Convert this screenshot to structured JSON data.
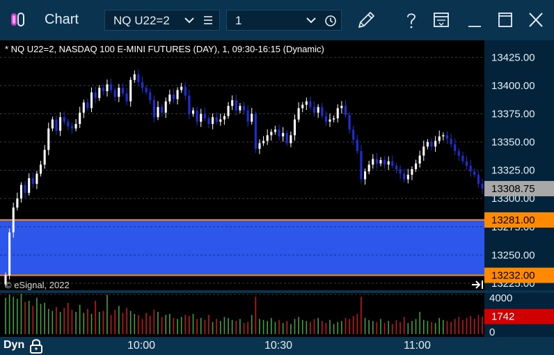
{
  "window": {
    "title": "Chart",
    "symbol": "NQ U22=2",
    "interval": "1",
    "icons": [
      "pencil-icon",
      "help-icon",
      "layout-icon",
      "minimize-icon",
      "maximize-icon",
      "close-icon"
    ]
  },
  "header": {
    "description": "* NQ U22=2, NASDAQ 100 E-MINI FUTURES (DAY), 1, 09:30-16:15 (Dynamic)"
  },
  "footer": {
    "copyright": "© eSignal, 2022",
    "mode": "Dyn"
  },
  "colors": {
    "title_bar": "#0a3350",
    "up_candle": "#ffffff",
    "down_candle": "#1e2ed8",
    "zone_fill": "#2f59f5",
    "zone_border": "#ff8a00",
    "last_price_tag": "#a8a8a8",
    "volume_tag": "#d00000",
    "volume_up": "#3ea23e",
    "volume_down": "#c41818"
  },
  "chart_data": {
    "type": "candlestick",
    "symbol": "NQ U22=2",
    "x_ticks": [
      "10:00",
      "10:30",
      "11:00"
    ],
    "price_ticks": [
      13425,
      13400,
      13375,
      13350,
      13325,
      13300,
      13275,
      13250,
      13225
    ],
    "price_tick_labels": [
      "13425.00",
      "13400.00",
      "13375.00",
      "13350.00",
      "13325.00",
      "13300.00",
      "13275.00",
      "13250.00",
      "13225.00"
    ],
    "ylim": [
      13220,
      13440
    ],
    "grid": true,
    "last_price": "13308.75",
    "last_price_value": 13308.75,
    "zone": {
      "upper": 13281,
      "lower": 13232,
      "upper_label": "13281.00",
      "lower_label": "13232.00"
    },
    "volume": {
      "axis_max_label": "4000",
      "axis_min_label": "0",
      "axis_max": 4000,
      "last_label": "1742",
      "last": 1742
    },
    "close_series": [
      13232,
      13270,
      13292,
      13300,
      13312,
      13305,
      13318,
      13313,
      13322,
      13330,
      13343,
      13362,
      13370,
      13360,
      13372,
      13368,
      13364,
      13362,
      13366,
      13376,
      13385,
      13380,
      13394,
      13389,
      13398,
      13395,
      13401,
      13396,
      13390,
      13398,
      13393,
      13386,
      13405,
      13410,
      13403,
      13398,
      13394,
      13387,
      13372,
      13381,
      13376,
      13386,
      13392,
      13388,
      13396,
      13399,
      13391,
      13375,
      13378,
      13368,
      13375,
      13371,
      13366,
      13372,
      13368,
      13370,
      13373,
      13382,
      13387,
      13378,
      13382,
      13378,
      13368,
      13375,
      13344,
      13349,
      13351,
      13356,
      13359,
      13361,
      13355,
      13358,
      13349,
      13356,
      13370,
      13380,
      13383,
      13386,
      13381,
      13376,
      13381,
      13373,
      13368,
      13370,
      13371,
      13380,
      13382,
      13374,
      13361,
      13352,
      13342,
      13317,
      13324,
      13330,
      13335,
      13331,
      13334,
      13330,
      13333,
      13329,
      13326,
      13322,
      13317,
      13321,
      13326,
      13331,
      13338,
      13346,
      13350,
      13346,
      13351,
      13355,
      13356,
      13353,
      13348,
      13342,
      13338,
      13333,
      13329,
      13324,
      13321,
      13313,
      13308.75
    ],
    "volume_series": [
      3600,
      3900,
      3700,
      3500,
      4000,
      3200,
      3300,
      2800,
      3600,
      3000,
      3100,
      2500,
      2300,
      2700,
      2200,
      2600,
      3100,
      2400,
      2200,
      2900,
      2100,
      2500,
      2000,
      3300,
      2200,
      2300,
      3900,
      1900,
      2400,
      2800,
      2100,
      2600,
      2300,
      2000,
      1900,
      1500,
      2100,
      1800,
      2400,
      2200,
      1700,
      1900,
      2000,
      1600,
      1500,
      1700,
      1900,
      1800,
      2000,
      1500,
      1600,
      1400,
      1900,
      1200,
      1500,
      1300,
      1700,
      1600,
      1400,
      1300,
      1500,
      1100,
      1200,
      1900,
      3700,
      1500,
      1400,
      1300,
      1600,
      1200,
      1400,
      1100,
      1300,
      1000,
      1500,
      1700,
      1400,
      1300,
      1200,
      1500,
      1600,
      1300,
      1100,
      1400,
      1000,
      1200,
      1300,
      1600,
      1500,
      1800,
      2000,
      3700,
      1600,
      1400,
      1300,
      1200,
      1500,
      1100,
      1300,
      1000,
      1400,
      1200,
      1700,
      1100,
      1300,
      1500,
      2200,
      1400,
      1300,
      1200,
      1100,
      1600,
      1400,
      1300,
      1200,
      1500,
      1700,
      1400,
      1600,
      1800,
      1500,
      1900,
      1742
    ]
  }
}
